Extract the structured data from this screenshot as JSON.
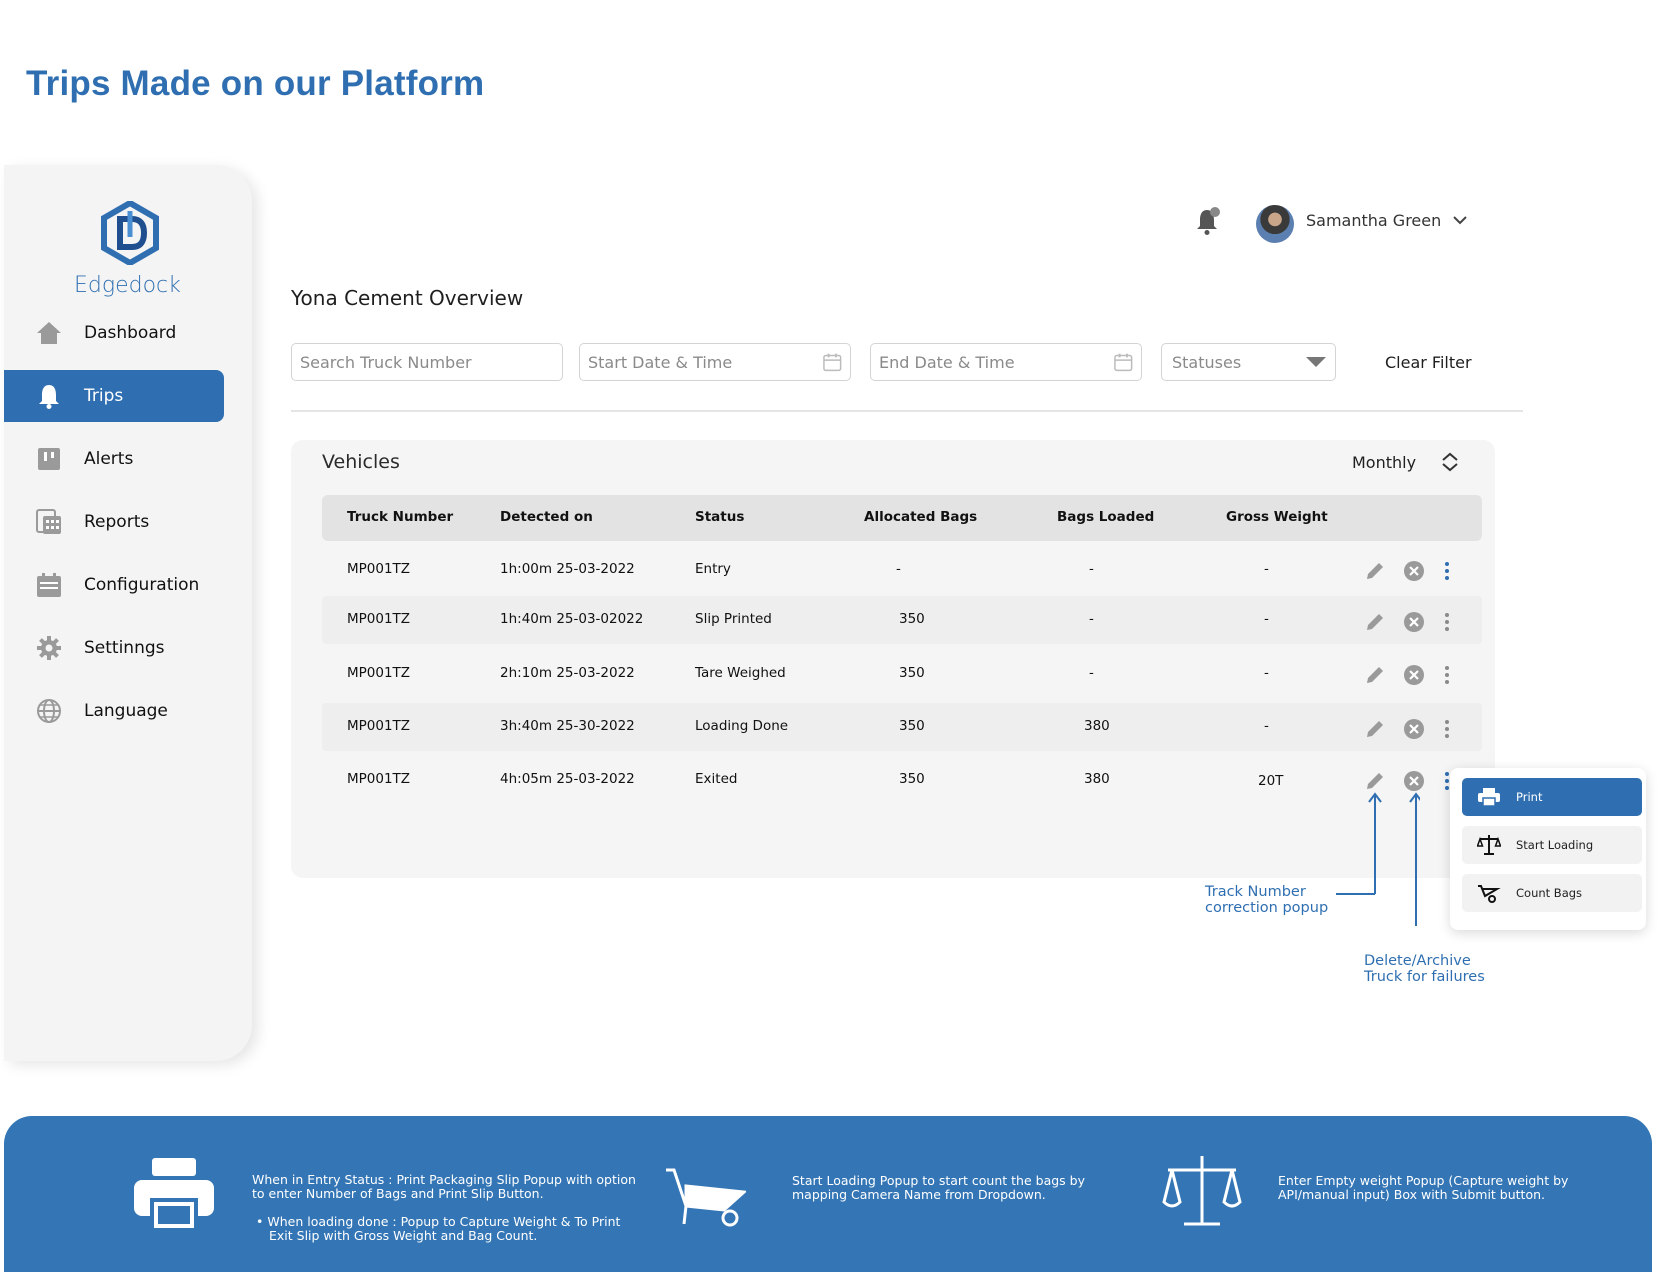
{
  "page_title": "Trips Made on our Platform",
  "logo_text": "Edgedock",
  "nav": [
    {
      "label": "Dashboard",
      "icon": "home-icon"
    },
    {
      "label": "Trips",
      "icon": "bell-icon"
    },
    {
      "label": "Alerts",
      "icon": "alert-board-icon"
    },
    {
      "label": "Reports",
      "icon": "reports-icon"
    },
    {
      "label": "Configuration",
      "icon": "calendar-config-icon"
    },
    {
      "label": "Settinngs",
      "icon": "gear-icon"
    },
    {
      "label": "Language",
      "icon": "globe-icon"
    }
  ],
  "header": {
    "user_name": "Samantha Green"
  },
  "section_title": "Yona Cement Overview",
  "filters": {
    "search_placeholder": "Search Truck Number",
    "start_placeholder": "Start Date & Time",
    "end_placeholder": "End Date & Time",
    "status_placeholder": "Statuses",
    "clear_label": "Clear Filter"
  },
  "vehicles": {
    "title": "Vehicles",
    "period": "Monthly",
    "columns": [
      "Truck Number",
      "Detected on",
      "Status",
      "Allocated Bags",
      "Bags Loaded",
      "Gross Weight"
    ],
    "rows": [
      [
        "MP001TZ",
        "1h:00m 25-03-2022",
        "Entry",
        "-",
        "-",
        "-"
      ],
      [
        "MP001TZ",
        "1h:40m 25-03-02022",
        "Slip Printed",
        "350",
        "-",
        "-"
      ],
      [
        "MP001TZ",
        "2h:10m 25-03-2022",
        "Tare Weighed",
        "350",
        "-",
        "-"
      ],
      [
        "MP001TZ",
        "3h:40m 25-30-2022",
        "Loading Done",
        "350",
        "380",
        "-"
      ],
      [
        "MP001TZ",
        "4h:05m 25-03-2022",
        "Exited",
        "350",
        "380",
        "20T"
      ]
    ]
  },
  "popup": {
    "print": "Print",
    "start_loading": "Start Loading",
    "count_bags": "Count Bags"
  },
  "annotations": {
    "track_line1": "Track Number",
    "track_line2": "correction popup",
    "delete_line1": "Delete/Archive",
    "delete_line2": "Truck for failures"
  },
  "banner": {
    "print_line1": "When in Entry Status : Print Packaging Slip Popup with option",
    "print_line2": "to enter Number of Bags and Print Slip Button.",
    "print_line3": "•  When loading done : Popup to Capture Weight & To Print",
    "print_line4": "Exit Slip with Gross Weight and Bag Count.",
    "loading_line1": "Start Loading Popup to start count the bags by",
    "loading_line2": "mapping Camera Name from Dropdown.",
    "weight_line1": "Enter Empty weight Popup (Capture weight by",
    "weight_line2": "API/manual input) Box with Submit button."
  },
  "colors": {
    "brand": "#2f6fb1",
    "banner": "#3375b5"
  }
}
